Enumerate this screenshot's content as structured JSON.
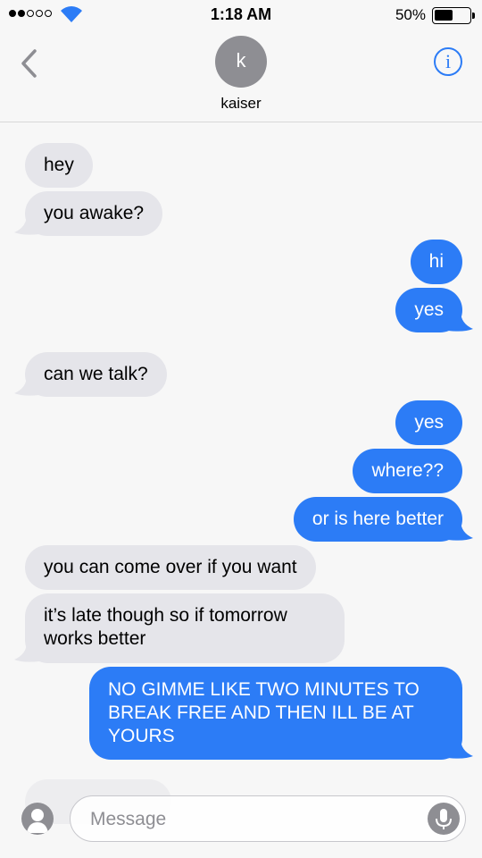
{
  "status": {
    "time": "1:18 AM",
    "battery": "50%"
  },
  "header": {
    "avatar_letter": "k",
    "name": "kaiser"
  },
  "messages": [
    {
      "text": "hey"
    },
    {
      "text": "you awake?"
    },
    {
      "text": "hi"
    },
    {
      "text": "yes"
    },
    {
      "text": "can we talk?"
    },
    {
      "text": "yes"
    },
    {
      "text": "where??"
    },
    {
      "text": "or is here better"
    },
    {
      "text": "you can come over if you want"
    },
    {
      "text": "it’s late though so if tomorrow works better"
    },
    {
      "text": "NO GIMME LIKE TWO MINUTES TO BREAK FREE AND THEN ILL BE AT YOURS"
    }
  ],
  "input": {
    "placeholder": "Message"
  },
  "colors": {
    "accent": "#2c7cf6",
    "incoming": "#e5e5ea"
  }
}
